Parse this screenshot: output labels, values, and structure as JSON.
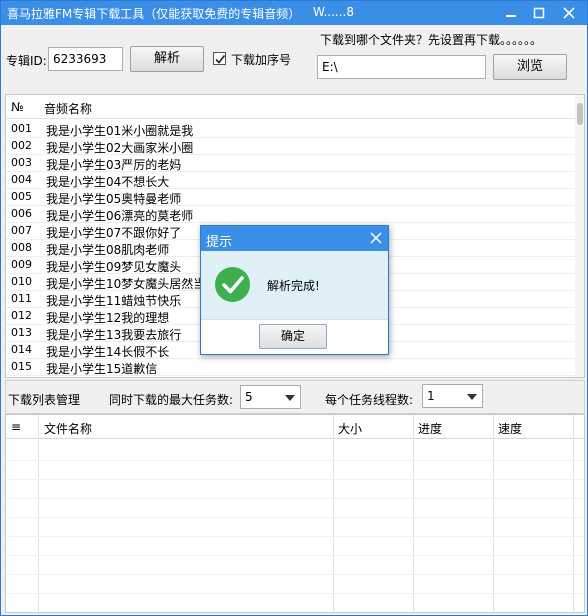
{
  "window": {
    "title": "喜马拉雅FM专辑下载工具（仅能获取免费的专辑音频）",
    "version": "W......8",
    "minimize_icon": "minimize-icon",
    "maximize_icon": "maximize-icon",
    "close_icon": "close-icon"
  },
  "toolbar": {
    "album_id_label": "专辑ID:",
    "album_id_value": "6233693",
    "parse_button": "解析",
    "download_with_index_label": "下载加序号",
    "download_with_index_checked": true,
    "folder_prompt": "下载到哪个文件夹？先设置再下载。。。。。。",
    "folder_path": "E:\\",
    "browse_button": "浏览"
  },
  "audio_list": {
    "columns": [
      "№",
      "音频名称"
    ],
    "rows": [
      {
        "num": "001",
        "name": "我是小学生01米小圈就是我"
      },
      {
        "num": "002",
        "name": "我是小学生02大画家米小圈"
      },
      {
        "num": "003",
        "name": "我是小学生03严厉的老妈"
      },
      {
        "num": "004",
        "name": "我是小学生04不想长大"
      },
      {
        "num": "005",
        "name": "我是小学生05奥特曼老师"
      },
      {
        "num": "006",
        "name": "我是小学生06漂亮的莫老师"
      },
      {
        "num": "007",
        "name": "我是小学生07不跟你好了"
      },
      {
        "num": "008",
        "name": "我是小学生08肌肉老师"
      },
      {
        "num": "009",
        "name": "我是小学生09梦见女魔头"
      },
      {
        "num": "010",
        "name": "我是小学生10梦女魔头居然当"
      },
      {
        "num": "011",
        "name": "我是小学生11蜡烛节快乐"
      },
      {
        "num": "012",
        "name": "我是小学生12我的理想"
      },
      {
        "num": "013",
        "name": "我是小学生13我要去旅行"
      },
      {
        "num": "014",
        "name": "我是小学生14长假不长"
      },
      {
        "num": "015",
        "name": "我是小学生15道歉信"
      }
    ]
  },
  "download_manager": {
    "label": "下载列表管理",
    "max_tasks_label": "同时下载的最大任务数:",
    "max_tasks_value": "5",
    "threads_label": "每个任务线程数:",
    "threads_value": "1",
    "columns": [
      "≡",
      "文件名称",
      "大小",
      "进度",
      "速度"
    ]
  },
  "dialog": {
    "title": "提示",
    "message": "解析完成!",
    "ok_button": "确定",
    "icon": "success-check-icon"
  },
  "colors": {
    "titlebar": "#3a8ee6",
    "dialog_body": "#dff0f7",
    "success": "#3fae4c"
  }
}
